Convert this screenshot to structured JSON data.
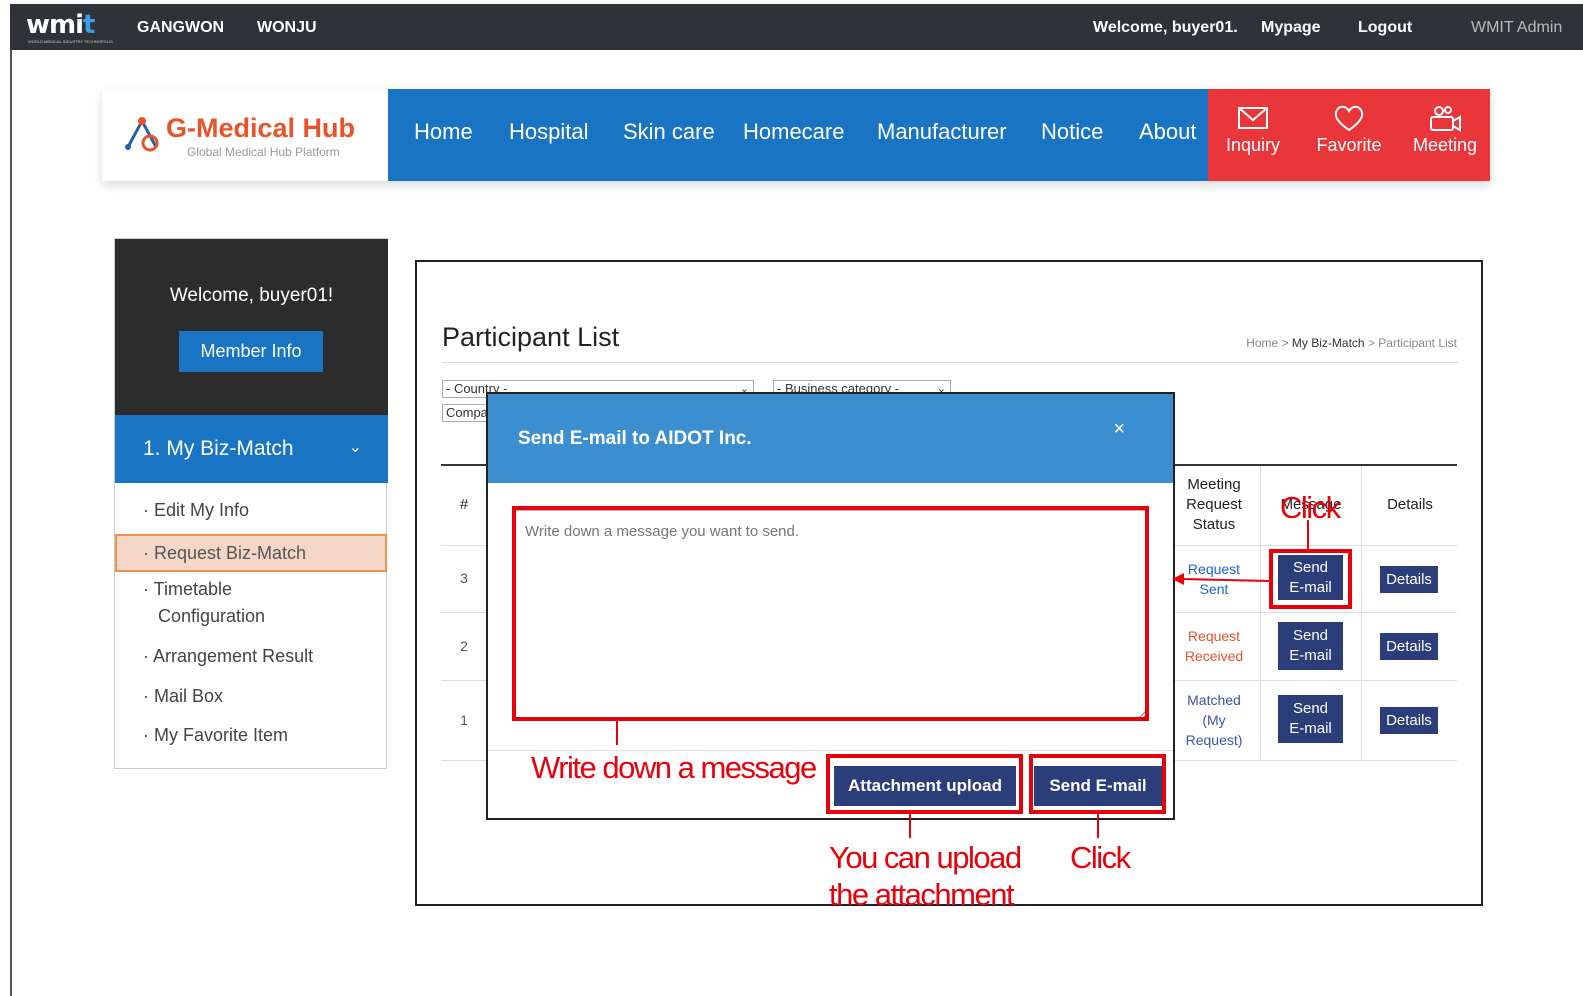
{
  "topbar": {
    "logo": "wmi",
    "logo_accent": "t",
    "logo_sub": "WORLD MEDICAL INDUSTRY TECHNOPOLIS",
    "city1": "GANGWON",
    "city2": "WONJU",
    "welcome": "Welcome, buyer01.",
    "mypage": "Mypage",
    "logout": "Logout",
    "admin": "WMIT Admin"
  },
  "brand": {
    "name": "G-Medical Hub",
    "tagline": "Global Medical Hub Platform"
  },
  "nav": {
    "items": [
      "Home",
      "Hospital",
      "Skin care",
      "Homecare",
      "Manufacturer",
      "Notice",
      "About"
    ],
    "actions": [
      {
        "label": "Inquiry",
        "icon": "envelope-icon"
      },
      {
        "label": "Favorite",
        "icon": "heart-icon"
      },
      {
        "label": "Meeting",
        "icon": "video-meeting-icon"
      }
    ]
  },
  "sidebar": {
    "welcome": "Welcome, buyer01!",
    "member_info": "Member Info",
    "section": "1. My Biz-Match",
    "items": [
      "Edit My Info",
      "Request Biz-Match",
      "Timetable",
      "Configuration",
      "Arrangement Result",
      "Mail Box",
      "My Favorite Item"
    ],
    "active_item": "Request Biz-Match"
  },
  "page": {
    "title": "Participant List",
    "breadcrumb": [
      "Home",
      "My Biz-Match",
      "Participant List"
    ],
    "filters": {
      "country": "- Country -",
      "category": "- Business category -",
      "company": "Compa"
    }
  },
  "table": {
    "headers": {
      "num": "#",
      "status_1": "Meeting",
      "status_2": "Request",
      "status_3": "Status",
      "message": "Message",
      "details": "Details"
    },
    "rows": [
      {
        "num": "3",
        "status_1": "Request",
        "status_2": "Sent",
        "status_3": "",
        "status_color": "#1a63d8",
        "send_1": "Send",
        "send_2": "E-mail",
        "details": "Details"
      },
      {
        "num": "2",
        "status_1": "Request",
        "status_2": "Received",
        "status_3": "",
        "status_color": "#e8542a",
        "send_1": "Send",
        "send_2": "E-mail",
        "details": "Details"
      },
      {
        "num": "1",
        "status_1": "Matched",
        "status_2": "(My",
        "status_3": "Request)",
        "status_color": "#3d52a8",
        "send_1": "Send",
        "send_2": "E-mail",
        "details": "Details"
      }
    ]
  },
  "modal": {
    "title": "Send E-mail to AIDOT Inc.",
    "close": "×",
    "placeholder": "Write down a message you want to send.",
    "attach_label": "Attachment upload",
    "send_label": "Send E-mail"
  },
  "annotations": {
    "click_top": "Click",
    "write": "Write down a message",
    "upload_1": "You can upload",
    "upload_2": "the attachment",
    "click_bottom": "Click"
  },
  "colors": {
    "accent_blue": "#1a74c4",
    "accent_red": "#e8363a",
    "annotation_red": "#e8000b",
    "button_navy": "#2c3e7a"
  }
}
